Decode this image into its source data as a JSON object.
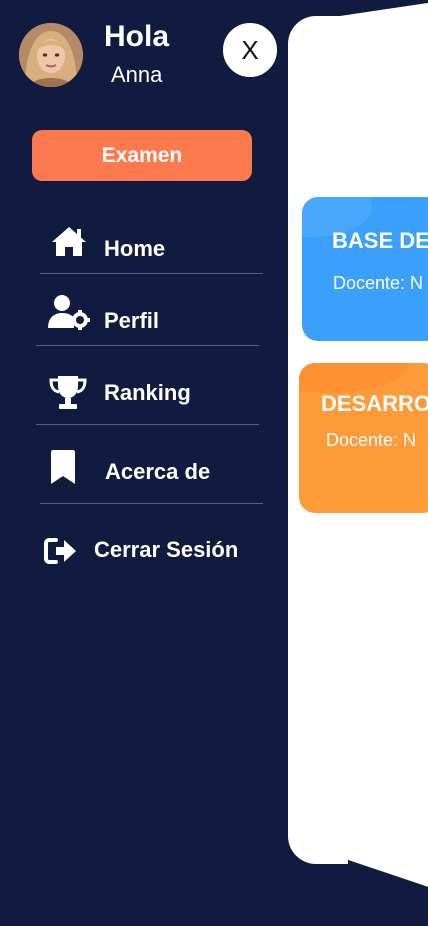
{
  "drawer": {
    "greeting": "Hola",
    "user_name": "Anna",
    "close_label": "X",
    "exam_button": "Examen",
    "menu": [
      {
        "label": "Home",
        "icon": "home-icon"
      },
      {
        "label": "Perfil",
        "icon": "user-gear-icon"
      },
      {
        "label": "Ranking",
        "icon": "trophy-icon"
      },
      {
        "label": "Acerca de",
        "icon": "bookmark-icon"
      },
      {
        "label": "Cerrar Sesión",
        "icon": "logout-icon"
      }
    ]
  },
  "courses": [
    {
      "title": "BASE DE",
      "teacher": "Docente: N",
      "color": "#3aa0fb"
    },
    {
      "title": "DESARRO",
      "teacher": "Docente: N",
      "color": "#fd9a3a"
    }
  ],
  "colors": {
    "background": "#111a3f",
    "accent": "#fd7a4e",
    "card_blue": "#3aa0fb",
    "card_orange": "#fd9a3a"
  }
}
